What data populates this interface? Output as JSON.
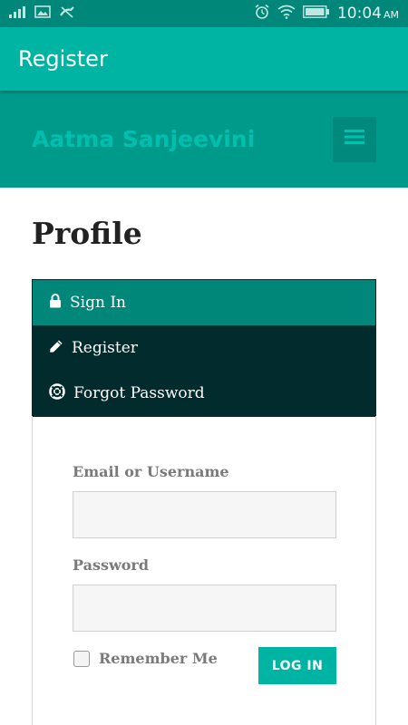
{
  "status_bar": {
    "time": "10:04",
    "ampm": "AM",
    "icons": [
      "signal-icon",
      "image-icon",
      "call-missed-icon",
      "alarm-icon",
      "wifi-icon",
      "battery-icon"
    ]
  },
  "app_bar": {
    "title": "Register"
  },
  "site_header": {
    "brand": "Aatma Sanjeevini",
    "menu_icon": "hamburger-menu-icon"
  },
  "page": {
    "title": "Profile"
  },
  "tabs": [
    {
      "label": "Sign In",
      "icon": "lock-icon",
      "active": true
    },
    {
      "label": "Register",
      "icon": "pencil-icon",
      "active": false
    },
    {
      "label": "Forgot Password",
      "icon": "lifebuoy-icon",
      "active": false
    }
  ],
  "form": {
    "email_label": "Email or Username",
    "email_value": "",
    "password_label": "Password",
    "password_value": "",
    "remember_label": "Remember Me",
    "remember_checked": false,
    "login_label": "LOG IN"
  },
  "colors": {
    "status_bar": "#00877a",
    "app_bar": "#00b4a4",
    "header": "#009a8b",
    "brand_text": "#00bfae",
    "tab_active": "#00877a",
    "tab_inactive": "#012b2d",
    "button": "#00b4a4"
  }
}
